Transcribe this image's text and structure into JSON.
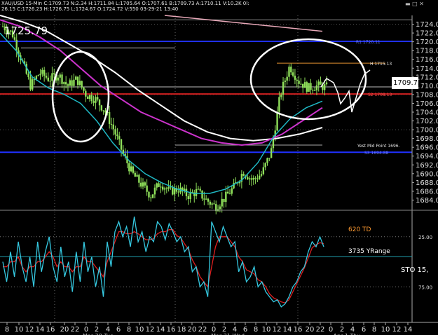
{
  "header": {
    "line1": "XAU/USD  15-Min  C:1709.73  N:2.34  H:1711.84  L:1705.64  O:1707.61  B:1709.73  A:1710.11  V:10.2K  0l:",
    "line2": "26.15  C:1726.23  H:1726.75  L:1724.67  O:1724.72  V:550  03-29-21  13:40",
    "window_controls": "▬ □ ✕"
  },
  "big_price": "1725.79",
  "current_price_label": "1709.73",
  "right_labels": {
    "r1": "R1  1720.11",
    "hi": "H 1715.13",
    "s2": "S2  1708.13",
    "midpoint": "Yest Mid Point  1696.",
    "s3": "S3  1694.88"
  },
  "indicator_text": {
    "td": "620 TD",
    "yrange": "3735 YRange",
    "sto": "STO  15,",
    "level_25": "25.00",
    "level_75": "75.00"
  },
  "colors": {
    "background": "#000000",
    "candles": "#8fe05a",
    "sma_fast": "#1fb8c4",
    "sma_mid": "#cc33cc",
    "sma_slow": "#ffffff",
    "blue_level": "#2030ff",
    "red_level": "#d02020",
    "sto_line": "#35c8e0",
    "sto_signal": "#e02020",
    "td_text": "#ff9a30"
  },
  "chart_data": [
    {
      "type": "candlestick",
      "instrument": "XAU/USD",
      "timeframe": "15-Min",
      "ylim": [
        1682,
        1726
      ],
      "y_ticks": [
        1724,
        1722,
        1720,
        1718,
        1716,
        1714,
        1712,
        1710,
        1708,
        1706,
        1704,
        1702,
        1700,
        1698,
        1696,
        1694,
        1692,
        1690,
        1688,
        1686,
        1684
      ],
      "y_tick_labels": [
        "1724.00",
        "1722.00",
        "1720.00",
        "1718.00",
        "1716.00",
        "1714.00",
        "1712.00",
        "1710.00",
        "1708.00",
        "1706.00",
        "1704.00",
        "1702.00",
        "1700.00",
        "1698.00",
        "1696.00",
        "1694.00",
        "1692.00",
        "1690.00",
        "1688.00",
        "1686.00",
        "1684.00"
      ],
      "x_tick_labels": [
        "8",
        "10",
        "12",
        "14",
        "16",
        "20",
        "22",
        "0",
        "2",
        "4",
        "6",
        "8",
        "10",
        "12",
        "14",
        "16",
        "18",
        "20",
        "22",
        "0",
        "2",
        "4",
        "6",
        "8",
        "10",
        "12",
        "14",
        "16",
        "20",
        "22",
        "0",
        "2",
        "4",
        "6",
        "8",
        "10",
        "12",
        "14"
      ],
      "day_labels": [
        "Mar 30 Tue",
        "Mar 31 Wed",
        "Apr 1 Thu"
      ],
      "close_path": [
        1723.5,
        1722.0,
        1716.0,
        1710.0,
        1713.0,
        1711.5,
        1712.5,
        1710.0,
        1711.5,
        1708.0,
        1707.0,
        1704.5,
        1700.0,
        1694.5,
        1690.0,
        1687.5,
        1685.0,
        1688.0,
        1686.0,
        1686.5,
        1685.0,
        1686.0,
        1684.0,
        1682.5,
        1684.5,
        1687.0,
        1690.5,
        1688.5,
        1690.0,
        1695.0,
        1708.0,
        1714.5,
        1711.0,
        1709.5,
        1710.0,
        1709.73
      ],
      "sma_fast_path": [
        1722.0,
        1718.0,
        1712.0,
        1709.5,
        1708.0,
        1706.0,
        1702.0,
        1697.0,
        1693.0,
        1690.0,
        1688.0,
        1686.5,
        1685.5,
        1685.5,
        1686.5,
        1688.5,
        1692.5,
        1698.5,
        1702.5,
        1705.0,
        1706.5
      ],
      "sma_mid_path": [
        1725.0,
        1723.5,
        1721.0,
        1718.0,
        1714.0,
        1710.0,
        1707.0,
        1704.0,
        1702.0,
        1700.0,
        1698.0,
        1697.0,
        1696.5,
        1697.0,
        1699.0,
        1702.0,
        1705.0
      ],
      "sma_slow_path": [
        1726.0,
        1724.5,
        1722.5,
        1719.5,
        1716.5,
        1713.0,
        1709.0,
        1705.5,
        1702.0,
        1699.5,
        1698.0,
        1697.5,
        1698.0,
        1699.0,
        1700.5
      ],
      "levels": [
        {
          "name": "R1",
          "value": 1720.11
        },
        {
          "name": "High",
          "value": 1715.13
        },
        {
          "name": "S2",
          "value": 1708.13
        },
        {
          "name": "Yest Mid Point",
          "value": 1696.5
        },
        {
          "name": "S3",
          "value": 1694.88
        }
      ],
      "current": 1709.73
    },
    {
      "type": "line",
      "indicator": "STO",
      "levels": [
        25,
        75
      ],
      "ylim": [
        0,
        100
      ],
      "k_line": [
        50,
        70,
        40,
        65,
        30,
        55,
        70,
        45,
        75,
        30,
        60,
        40,
        25,
        55,
        70,
        35,
        65,
        50,
        80,
        40,
        70,
        30,
        60,
        45,
        75,
        55,
        85,
        30,
        55,
        20,
        10,
        25,
        15,
        35,
        5,
        30,
        20,
        40,
        25,
        30,
        10,
        15,
        28,
        12,
        20,
        30,
        25,
        40,
        35,
        60,
        55,
        75,
        70,
        85,
        10,
        20,
        30,
        15,
        25,
        35,
        30,
        60,
        50,
        70,
        65,
        55,
        75,
        70,
        80,
        85,
        90,
        88,
        95,
        92,
        85,
        75,
        70,
        60,
        55,
        40,
        30,
        35,
        25,
        35
      ],
      "d_line": [
        55,
        55,
        50,
        50,
        45,
        55,
        60,
        55,
        55,
        50,
        50,
        45,
        40,
        45,
        55,
        50,
        55,
        55,
        60,
        55,
        55,
        45,
        50,
        50,
        55,
        60,
        65,
        50,
        40,
        30,
        20,
        20,
        22,
        22,
        20,
        22,
        25,
        28,
        28,
        27,
        22,
        20,
        20,
        18,
        18,
        24,
        26,
        32,
        38,
        48,
        55,
        65,
        70,
        75,
        55,
        35,
        25,
        25,
        25,
        30,
        35,
        45,
        50,
        58,
        60,
        62,
        68,
        70,
        75,
        82,
        86,
        88,
        90,
        91,
        88,
        80,
        72,
        64,
        56,
        46,
        36,
        33,
        31,
        32
      ]
    }
  ]
}
